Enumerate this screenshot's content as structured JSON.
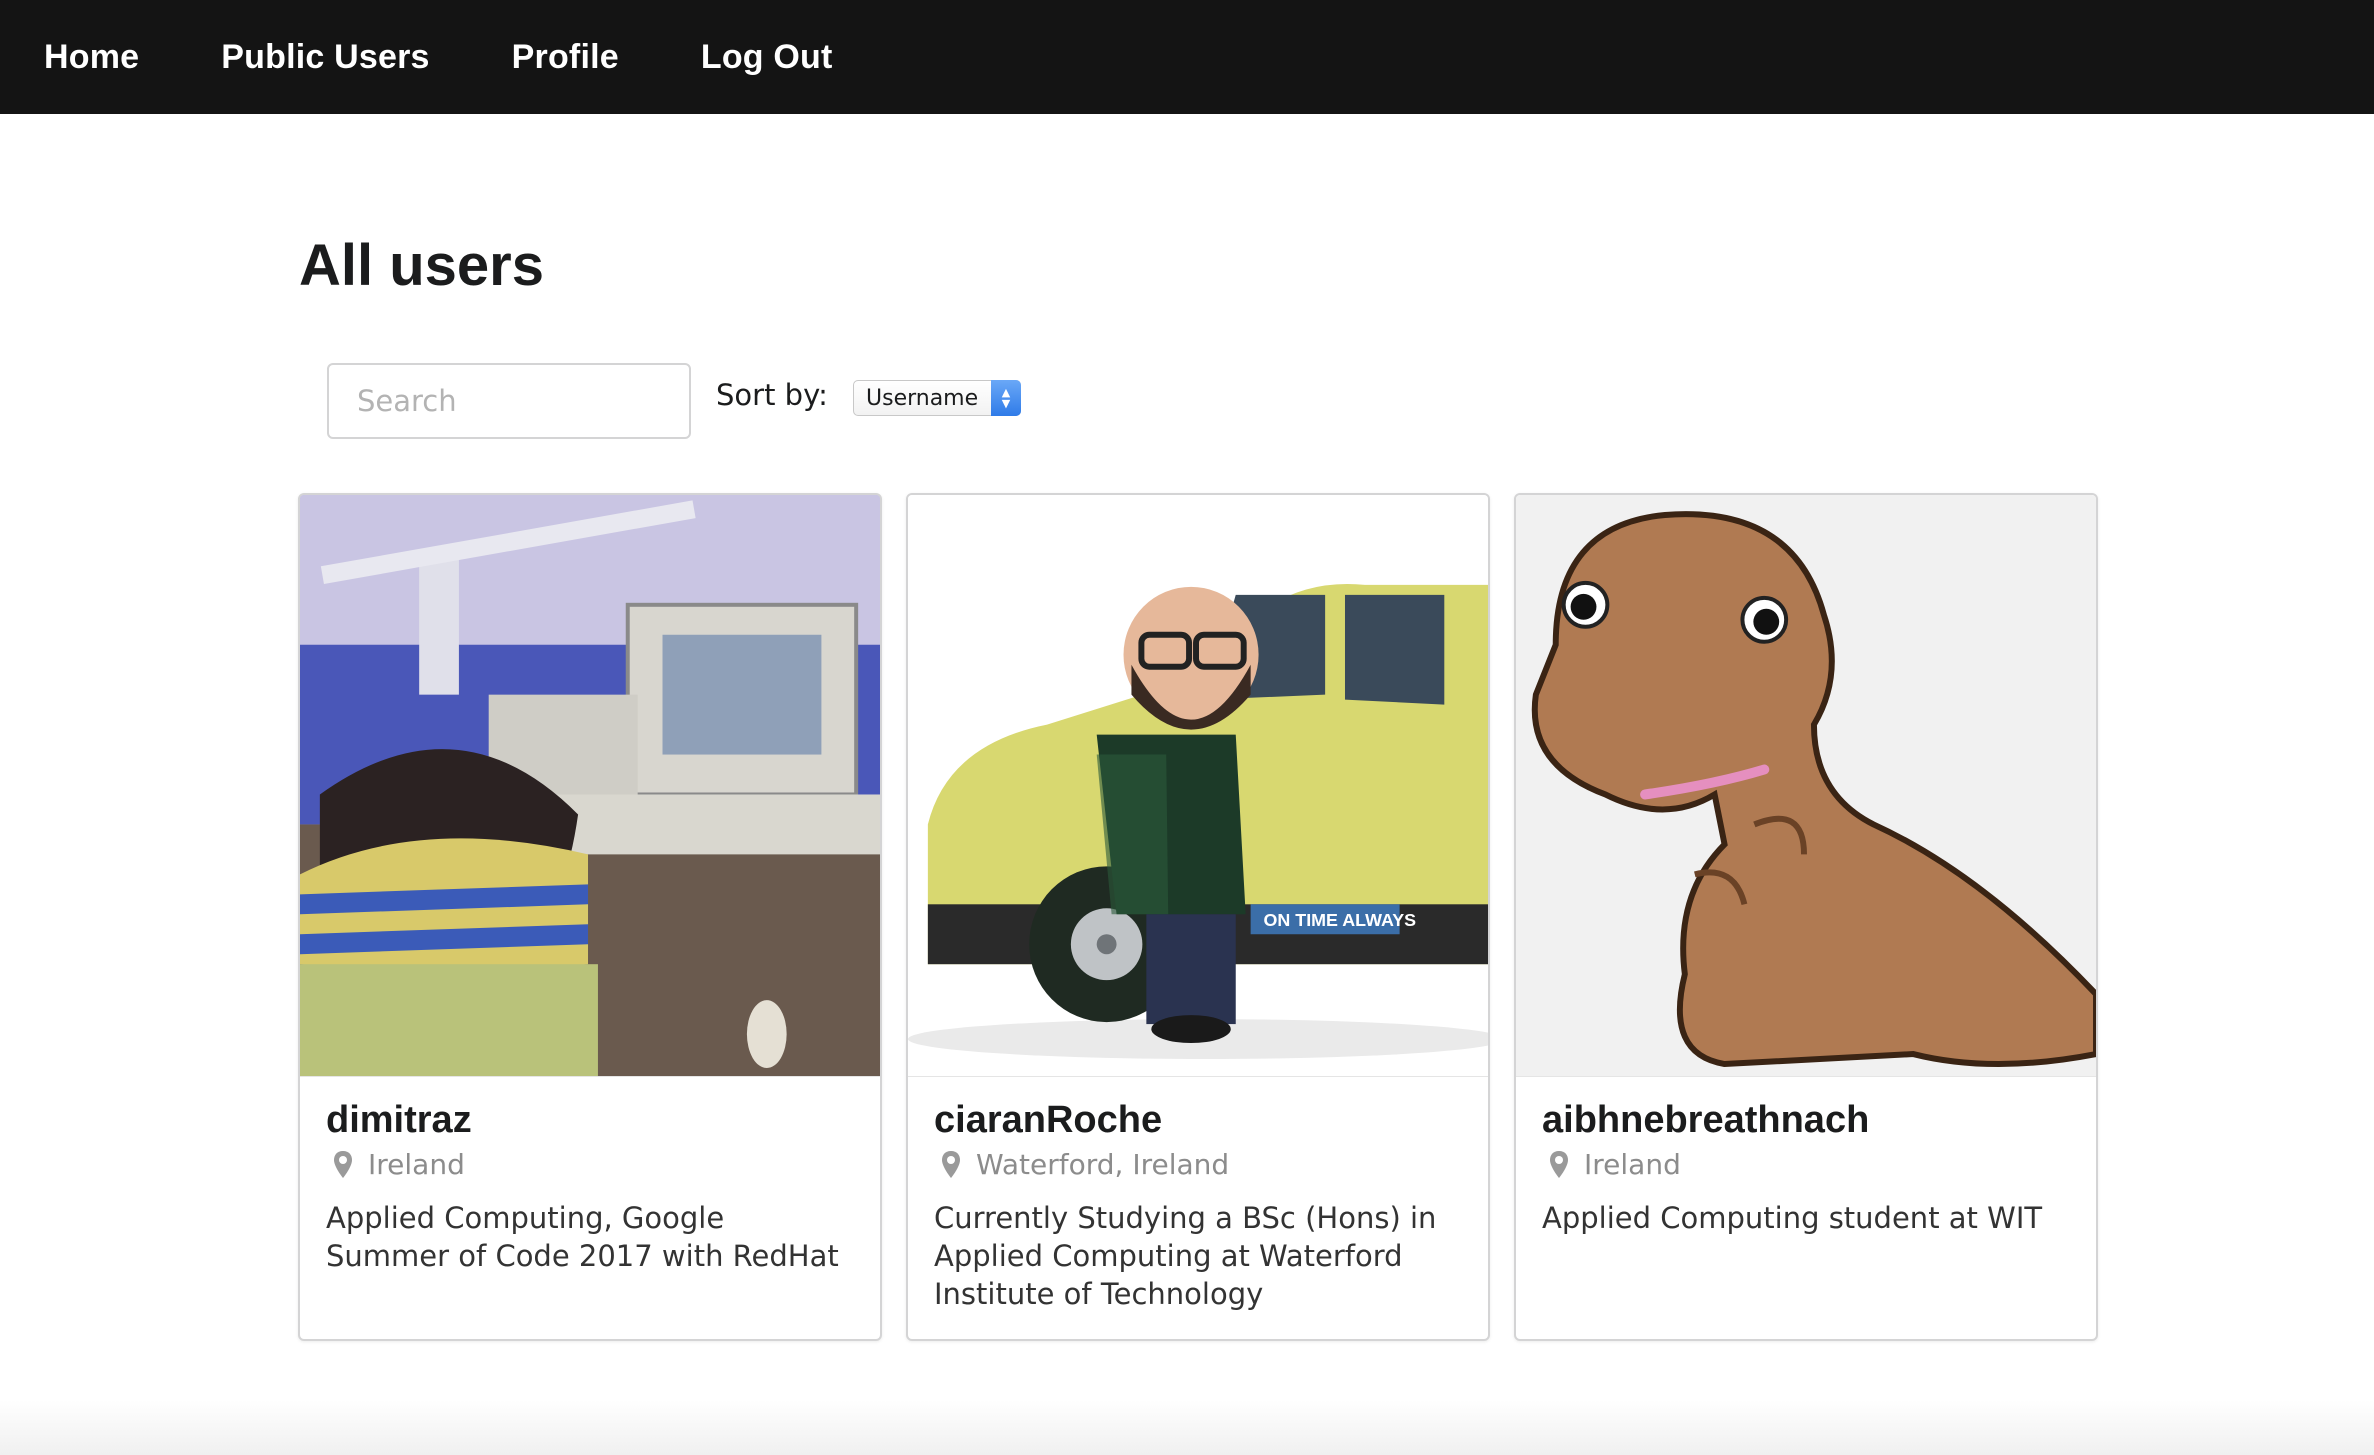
{
  "nav": {
    "items": [
      {
        "label": "Home"
      },
      {
        "label": "Public Users"
      },
      {
        "label": "Profile"
      },
      {
        "label": "Log Out"
      }
    ]
  },
  "page": {
    "title": "All users"
  },
  "search": {
    "placeholder": "Search",
    "value": ""
  },
  "sort": {
    "label": "Sort by:",
    "selected": "Username"
  },
  "icons": {
    "location": "map-pin-icon",
    "select_arrows": "up-down-chevron-icon"
  },
  "users": [
    {
      "name": "dimitraz",
      "location": "Ireland",
      "description": "Applied Computing,  Google Summer of Code 2017 with RedHat",
      "avatar": "anime-girl-at-computer-image"
    },
    {
      "name": "ciaranRoche",
      "location": "Waterford, Ireland",
      "description": "Currently Studying a BSc (Hons) in Applied Computing at Waterford Institute of Technology",
      "avatar": "bitmoji-man-with-van-image",
      "avatar_text": "ON TIME ALWAYS"
    },
    {
      "name": "aibhnebreathnach",
      "location": "Ireland",
      "description": "Applied Computing student at WIT",
      "avatar": "plush-dinosaur-image"
    }
  ],
  "colors": {
    "topbar": "#141414",
    "select_accent": "#2f7be8",
    "card_border": "#d4d4d5"
  }
}
